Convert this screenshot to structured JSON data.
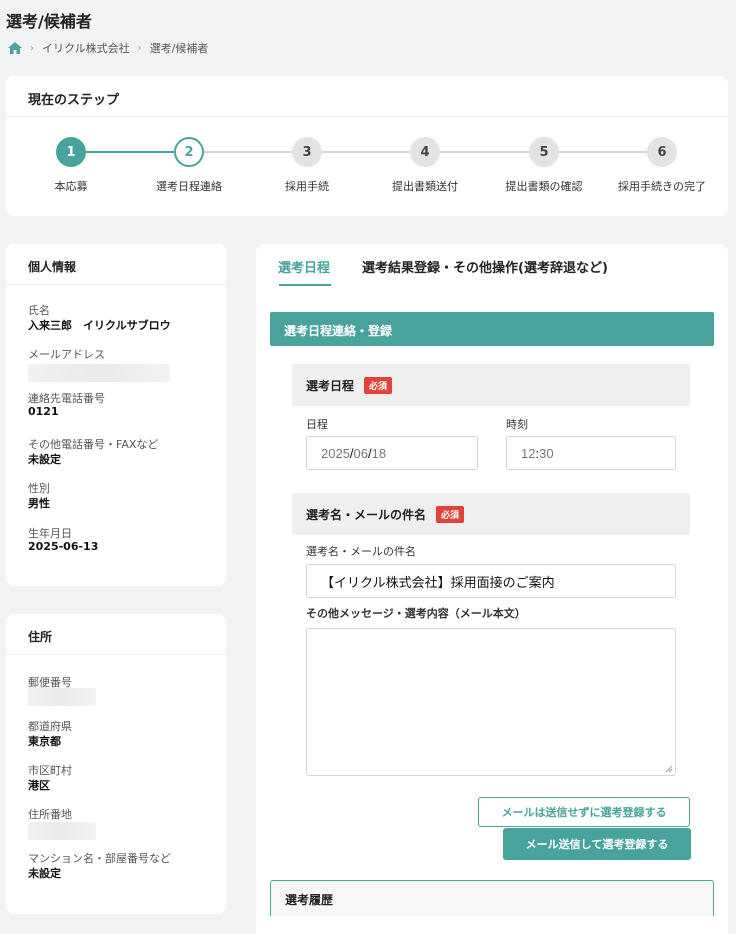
{
  "page": {
    "title": "選考/候補者"
  },
  "breadcrumb": {
    "items": [
      "イリクル株式会社",
      "選考/候補者"
    ]
  },
  "steps": {
    "title": "現在のステップ",
    "items": [
      {
        "num": "1",
        "label": "本応募"
      },
      {
        "num": "2",
        "label": "選考日程連絡"
      },
      {
        "num": "3",
        "label": "採用手続"
      },
      {
        "num": "4",
        "label": "提出書類送付"
      },
      {
        "num": "5",
        "label": "提出書類の確認"
      },
      {
        "num": "6",
        "label": "採用手続きの完了"
      }
    ]
  },
  "personal": {
    "title": "個人情報",
    "name_label": "氏名",
    "name_value": "入来三郎　イリクルサブロウ",
    "email_label": "メールアドレス",
    "phone_label": "連絡先電話番号",
    "phone_value": "0121",
    "other_phone_label": "その他電話番号・FAXなど",
    "other_phone_value": "未設定",
    "gender_label": "性別",
    "gender_value": "男性",
    "birth_label": "生年月日",
    "birth_value": "2025-06-13"
  },
  "address": {
    "title": "住所",
    "postal_label": "郵便番号",
    "prefecture_label": "都道府県",
    "prefecture_value": "東京都",
    "city_label": "市区町村",
    "city_value": "港区",
    "street_label": "住所番地",
    "building_label": "マンション名・部屋番号など",
    "building_value": "未設定"
  },
  "tabs": [
    {
      "label": "選考日程"
    },
    {
      "label": "選考結果登録・その他操作(選考辞退など)"
    }
  ],
  "schedule": {
    "section_title": "選考日程連絡・登録",
    "schedule_title": "選考日程",
    "required": "必須",
    "date_label": "日程",
    "date_y": "2025",
    "date_m": "06",
    "date_d": "18",
    "time_label": "時刻",
    "time_h": "12",
    "time_m": "30",
    "subject_title": "選考名・メールの件名",
    "subject_label": "選考名・メールの件名",
    "subject_value": "【イリクル株式会社】採用面接のご案内",
    "message_label": "その他メッセージ・選考内容（メール本文）"
  },
  "buttons": {
    "register_without_mail": "メールは送信せずに選考登録する",
    "register_with_mail": "メール送信して選考登録する"
  },
  "history": {
    "title": "選考履歴"
  },
  "colors": {
    "accent": "#49a39d",
    "required": "#e0433a"
  }
}
